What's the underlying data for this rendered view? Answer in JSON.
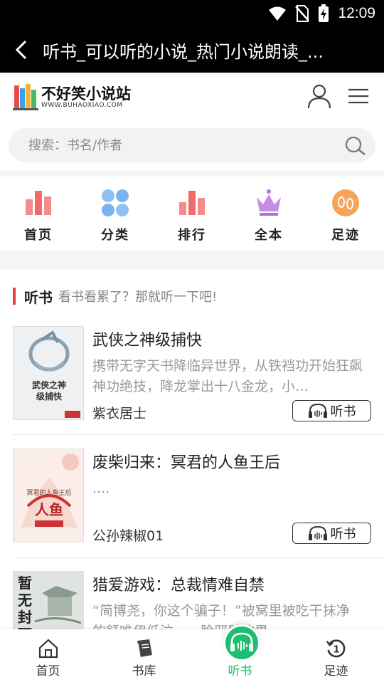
{
  "status": {
    "time": "12:09",
    "wifi_icon": "wifi-icon",
    "sim_icon": "no-sim-icon",
    "battery_icon": "battery-charging-icon"
  },
  "titlebar": {
    "title": "听书_可以听的小说_热门小说朗读_...",
    "back_icon": "chevron-left-icon"
  },
  "header": {
    "logo_text": "不好笑小说站",
    "logo_url": "WWW.BUHAOXIAO.COM",
    "user_icon": "user-icon",
    "menu_icon": "menu-icon"
  },
  "search": {
    "placeholder": "搜索：书名/作者",
    "icon": "search-icon"
  },
  "nav": [
    {
      "label": "首页",
      "icon": "bar-chart-icon",
      "color": "#f06b6b"
    },
    {
      "label": "分类",
      "icon": "grid-dots-icon",
      "color": "#7ab4f0"
    },
    {
      "label": "排行",
      "icon": "ranking-icon",
      "color": "#f06b6b"
    },
    {
      "label": "全本",
      "icon": "crown-icon",
      "color": "#b56de0"
    },
    {
      "label": "足迹",
      "icon": "footprint-icon",
      "color": "#f5a45a"
    }
  ],
  "section": {
    "title": "听书",
    "subtitle": "看书看累了？那就听一下吧!"
  },
  "books": [
    {
      "title": "武侠之神级捕快",
      "desc": "携带无字天书降临异世界，从铁裆功开始狂飙神功绝技，降龙掌出十八金龙，小…",
      "author": "紫衣居士",
      "listen_label": "听书",
      "cover_text": "武侠之神级捕快"
    },
    {
      "title": "废柴归来：冥君的人鱼王后",
      "desc": "....",
      "author": "公孙辣椒01",
      "listen_label": "听书",
      "cover_text": "冥君的人鱼王后"
    },
    {
      "title": "猎爱游戏：总裁情难自禁",
      "desc": "“简博尧，你这个骗子！”被窝里被吃干抹净的舒唯伊低泣……脸邪肆的男…",
      "author": "",
      "listen_label": "听书",
      "cover_text": "暂无封面"
    }
  ],
  "tabs": [
    {
      "label": "首页",
      "icon": "home-icon"
    },
    {
      "label": "书库",
      "icon": "book-icon"
    },
    {
      "label": "听书",
      "icon": "headphones-icon",
      "active": true
    },
    {
      "label": "足迹",
      "icon": "history-icon"
    }
  ],
  "colors": {
    "accent_green": "#1ebe70",
    "accent_red": "#e0413c"
  }
}
